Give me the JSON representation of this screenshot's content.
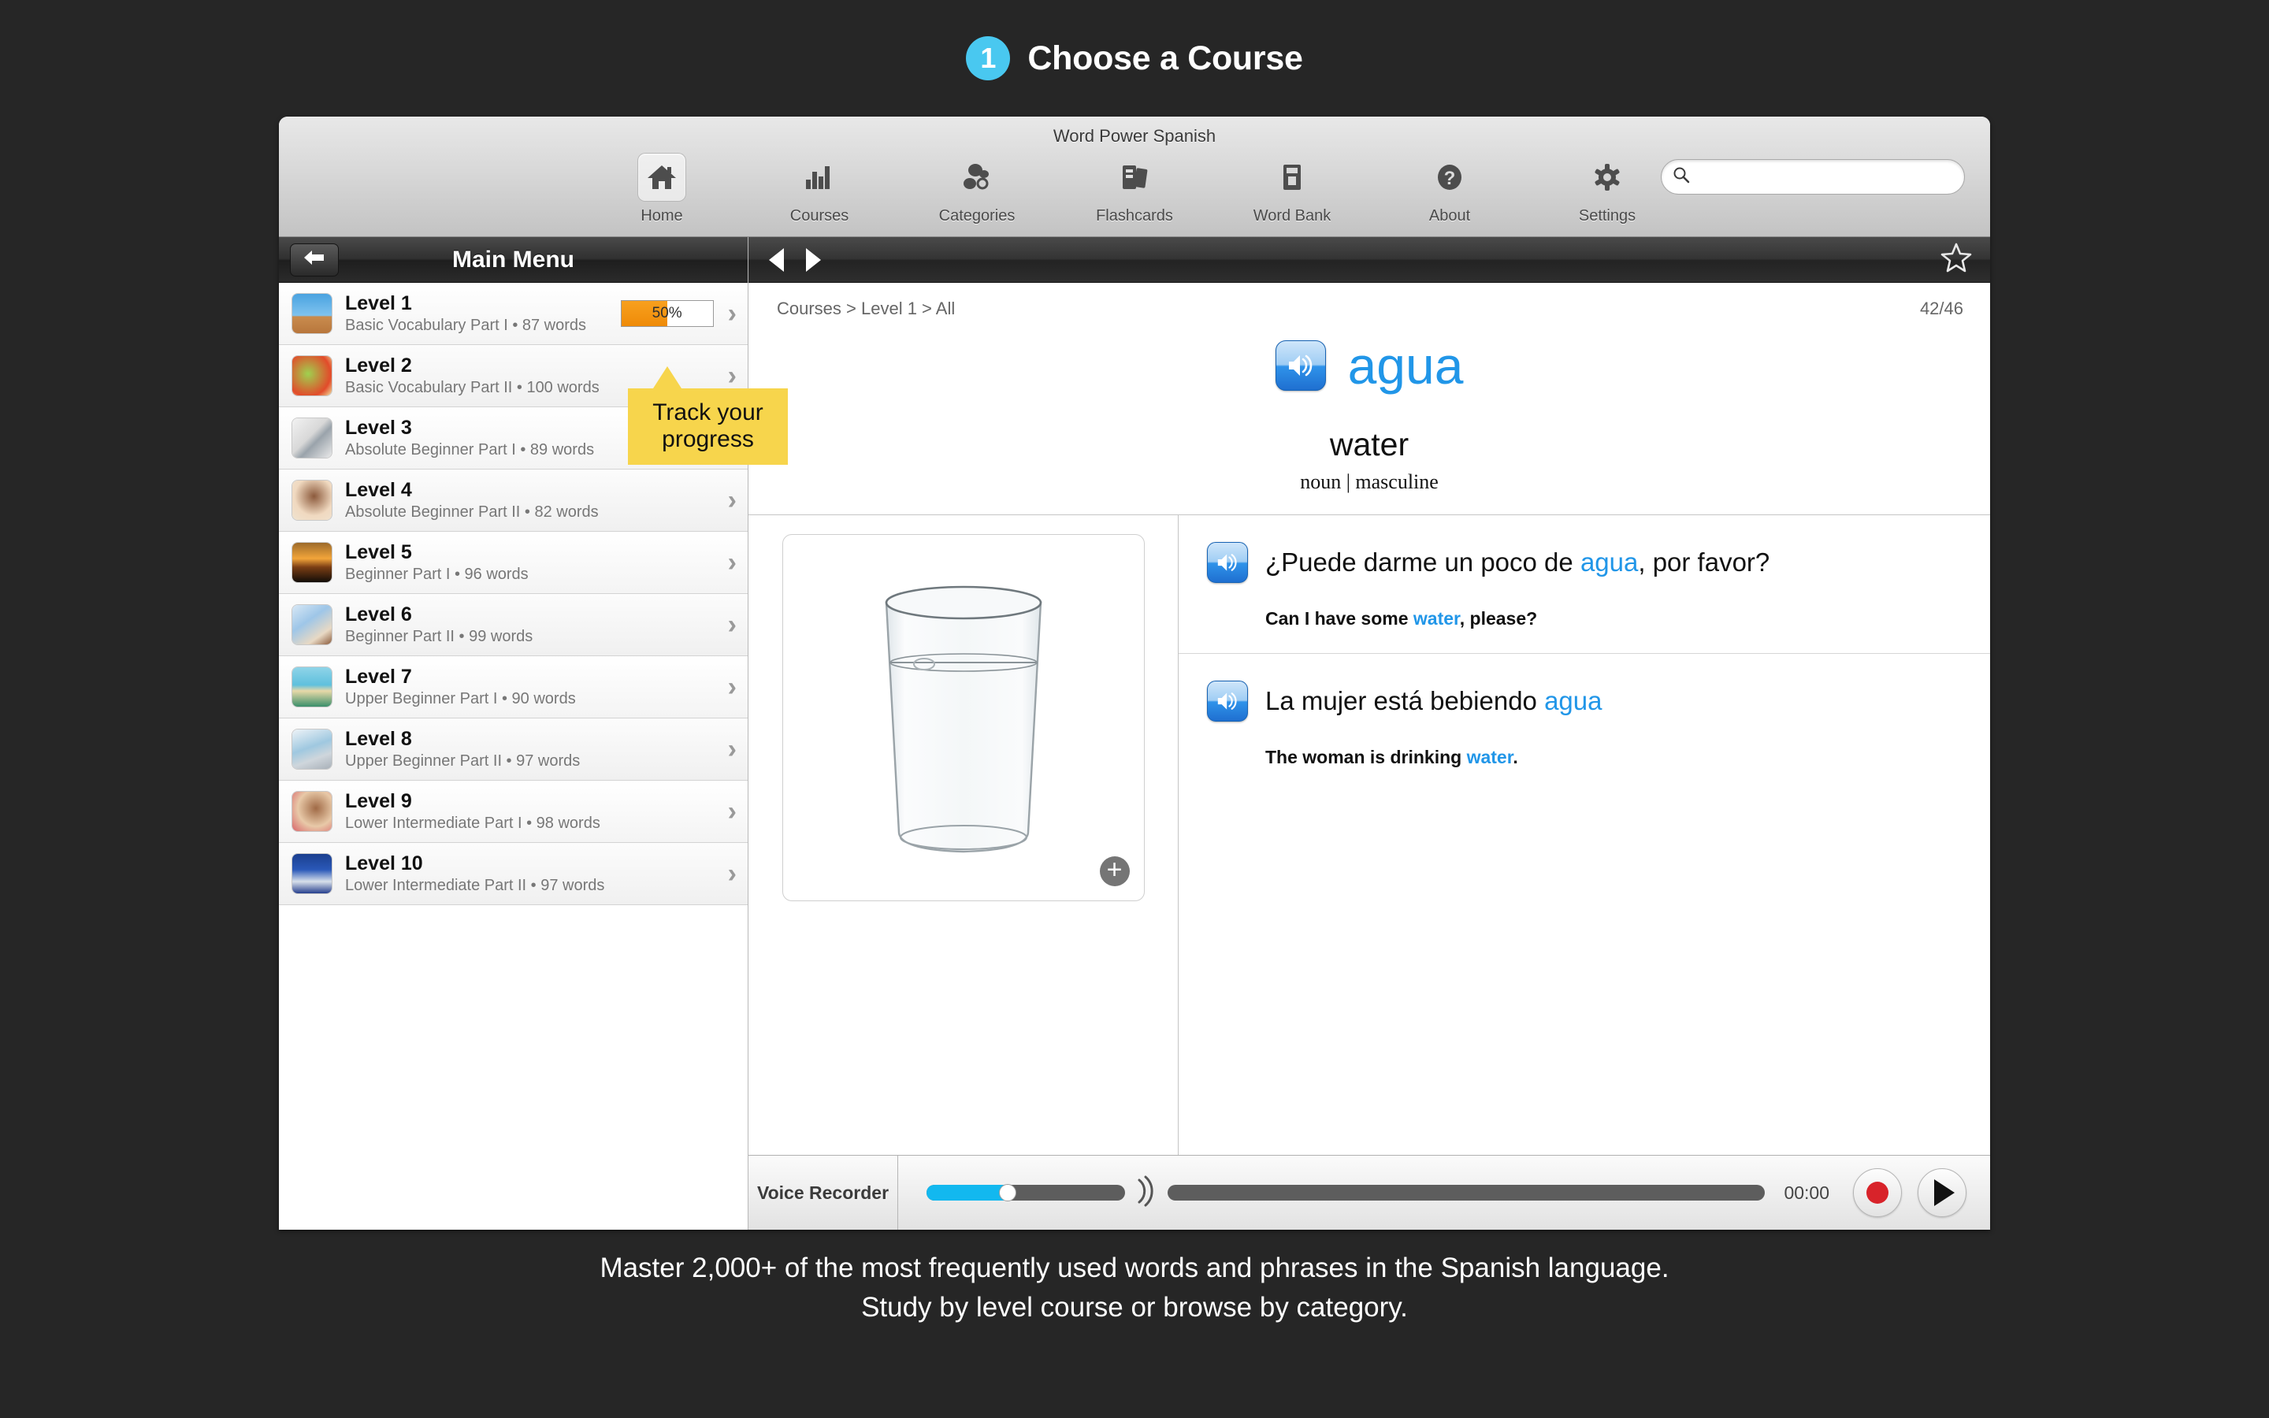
{
  "promo": {
    "step_number": "1",
    "title": "Choose a Course",
    "badge_color": "#49c8f0",
    "caption_line1": "Master 2,000+ of the most frequently used words and phrases in the Spanish language.",
    "caption_line2": "Study by level course or browse by category."
  },
  "window": {
    "title": "Word Power Spanish"
  },
  "toolbar": {
    "items": [
      {
        "label": "Home",
        "icon": "home-icon",
        "selected": true
      },
      {
        "label": "Courses",
        "icon": "bar-chart-icon",
        "selected": false
      },
      {
        "label": "Categories",
        "icon": "categories-icon",
        "selected": false
      },
      {
        "label": "Flashcards",
        "icon": "flashcards-icon",
        "selected": false
      },
      {
        "label": "Word Bank",
        "icon": "word-bank-icon",
        "selected": false
      },
      {
        "label": "About",
        "icon": "question-mark-icon",
        "selected": false
      },
      {
        "label": "Settings",
        "icon": "gear-icon",
        "selected": false
      }
    ],
    "search": {
      "value": "",
      "placeholder": ""
    }
  },
  "sidebar": {
    "header_title": "Main Menu",
    "back_icon": "back-arrow-icon",
    "levels": [
      {
        "name": "Level 1",
        "subtitle": "Basic Vocabulary Part I • 87 words",
        "progress": "50%",
        "progress_pct": 50,
        "thumb": "hurdler"
      },
      {
        "name": "Level 2",
        "subtitle": "Basic Vocabulary Part II • 100 words",
        "progress": "",
        "progress_pct": 0,
        "thumb": "vegetables"
      },
      {
        "name": "Level 3",
        "subtitle": "Absolute Beginner Part I • 89 words",
        "progress": "",
        "progress_pct": 0,
        "thumb": "keys"
      },
      {
        "name": "Level 4",
        "subtitle": "Absolute Beginner Part II • 82 words",
        "progress": "",
        "progress_pct": 0,
        "thumb": "brushing-teeth"
      },
      {
        "name": "Level 5",
        "subtitle": "Beginner Part I • 96 words",
        "progress": "",
        "progress_pct": 0,
        "thumb": "sunset"
      },
      {
        "name": "Level 6",
        "subtitle": "Beginner Part II • 99 words",
        "progress": "",
        "progress_pct": 0,
        "thumb": "bed"
      },
      {
        "name": "Level 7",
        "subtitle": "Upper Beginner Part I • 90 words",
        "progress": "",
        "progress_pct": 0,
        "thumb": "hammock"
      },
      {
        "name": "Level 8",
        "subtitle": "Upper Beginner Part II • 97 words",
        "progress": "",
        "progress_pct": 0,
        "thumb": "laptop"
      },
      {
        "name": "Level 9",
        "subtitle": "Lower Intermediate Part I • 98 words",
        "progress": "",
        "progress_pct": 0,
        "thumb": "couple"
      },
      {
        "name": "Level 10",
        "subtitle": "Lower Intermediate Part II • 97 words",
        "progress": "",
        "progress_pct": 0,
        "thumb": "runner"
      }
    ]
  },
  "tooltip": {
    "text": "Track your progress",
    "color": "#f7d54c"
  },
  "content": {
    "prev_icon": "previous-arrow-icon",
    "next_icon": "next-arrow-icon",
    "star_icon": "star-outline-icon",
    "breadcrumb": "Courses > Level 1 > All",
    "counter": "42/46",
    "word": {
      "term": "agua",
      "term_color": "#2196e8",
      "translation": "water",
      "part_of_speech": "noun | masculine",
      "audio_icon": "speaker-icon"
    },
    "image": {
      "alt": "glass-of-water",
      "expand_icon": "plus-circle-icon"
    },
    "sentences": [
      {
        "audio_icon": "speaker-icon",
        "es_before": "¿Puede darme un poco de ",
        "es_highlight": "agua",
        "es_after": ", por favor?",
        "en_before": "Can I have some ",
        "en_highlight": "water",
        "en_after": ", please?"
      },
      {
        "audio_icon": "speaker-icon",
        "es_before": "La mujer está bebiendo ",
        "es_highlight": "agua",
        "es_after": "",
        "en_before": "The woman is drinking ",
        "en_highlight": "water",
        "en_after": "."
      }
    ]
  },
  "recorder": {
    "label": "Voice Recorder",
    "volume_pct": 41,
    "volume_color": "#12b8ef",
    "speaker_icon": "volume-waves-icon",
    "time": "00:00",
    "record_icon": "record-dot-icon",
    "play_icon": "play-triangle-icon"
  }
}
